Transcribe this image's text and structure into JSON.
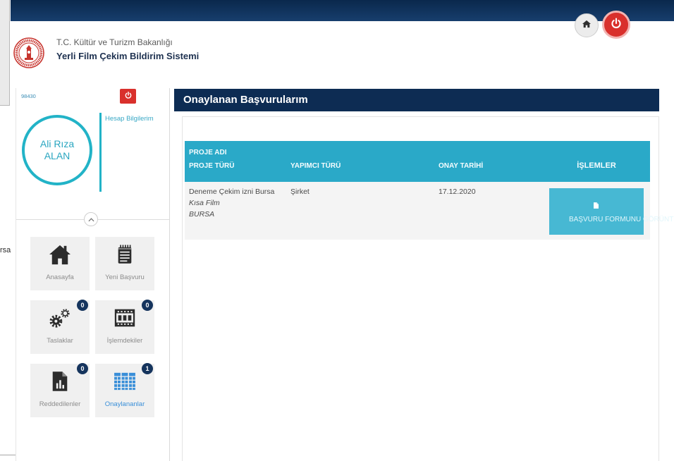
{
  "colors": {
    "navy": "#0d2c53",
    "teal": "#2aa9c8",
    "teal_button": "#47b8d3",
    "circle_teal": "#22b3c7",
    "power_red": "#d9302c",
    "badge": "#15345d",
    "active": "#3a8fd8"
  },
  "background_window": {
    "fragment_text": "rsa"
  },
  "header": {
    "ministry": "T.C. Kültür ve Turizm Bakanlığı",
    "system_title": "Yerli Film Çekim Bildirim Sistemi",
    "logo_icon": "ministry-emblem-icon",
    "home_button_icon": "home-icon",
    "exit_button_icon": "power-icon"
  },
  "sidebar": {
    "user_id": "98430",
    "logout_icon": "power-icon",
    "user_name": {
      "first": "Ali Rıza",
      "last": "ALAN"
    },
    "account_link": "Hesap Bilgilerim",
    "collapse_icon": "chevron-up-icon",
    "tiles": [
      {
        "label": "Anasayfa",
        "icon": "home-icon"
      },
      {
        "label": "Yeni Başvuru",
        "icon": "notepad-icon"
      },
      {
        "label": "Taslaklar",
        "icon": "gears-icon",
        "badge": 0
      },
      {
        "label": "İşlemdekiler",
        "icon": "film-frame-icon",
        "badge": 0
      },
      {
        "label": "Reddedilenler",
        "icon": "document-chart-icon",
        "badge": 0
      },
      {
        "label": "Onaylananlar",
        "icon": "approved-columns-icon",
        "badge": 1,
        "active": true
      }
    ]
  },
  "main": {
    "title": "Onaylanan Başvurularım",
    "table": {
      "headers": {
        "project_name": "PROJE ADI",
        "project_type": "PROJE TÜRÜ",
        "producer_type": "YAPIMCI TÜRÜ",
        "approval_date": "ONAY TARİHİ",
        "actions": "İŞLEMLER"
      },
      "rows": [
        {
          "project_name": "Deneme Çekim izni Bursa",
          "project_type": "Kısa Film",
          "city": "BURSA",
          "producer_type": "Şirket",
          "approval_date": "17.12.2020",
          "action_label": "BAŞVURU FORMUNU GÖRÜNTÜLE",
          "action_icon": "document-icon"
        }
      ]
    }
  }
}
